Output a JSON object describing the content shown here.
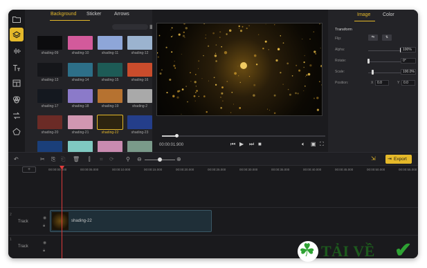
{
  "asset_panel": {
    "tabs": [
      "Background",
      "Sticker",
      "Arrows"
    ],
    "active_tab": 0,
    "thumbnails": [
      {
        "label": "shading-09",
        "color": "#0c0c0e",
        "selected": false
      },
      {
        "label": "shading-10",
        "color": "#d35a9b",
        "selected": false
      },
      {
        "label": "shading-11",
        "color": "#8ea6d8",
        "selected": false
      },
      {
        "label": "shading-12",
        "color": "#9bb3cf",
        "selected": false
      },
      {
        "label": "shading-13",
        "color": "#15161a",
        "selected": false
      },
      {
        "label": "shading-14",
        "color": "#2d6f88",
        "selected": false
      },
      {
        "label": "shading-15",
        "color": "#1d5b56",
        "selected": false
      },
      {
        "label": "shading-16",
        "color": "#c94c2c",
        "selected": false
      },
      {
        "label": "shading-17",
        "color": "#14181f",
        "selected": false
      },
      {
        "label": "shading-18",
        "color": "#8b7ac9",
        "selected": false
      },
      {
        "label": "shading-19",
        "color": "#b67230",
        "selected": false
      },
      {
        "label": "shading-2",
        "color": "#a9a9a9",
        "selected": false
      },
      {
        "label": "shading-20",
        "color": "#6b2b26",
        "selected": false
      },
      {
        "label": "shading-21",
        "color": "#d197b1",
        "selected": false
      },
      {
        "label": "shading-22",
        "color": "#2c2410",
        "selected": true
      },
      {
        "label": "shading-23",
        "color": "#243e8a",
        "selected": false
      },
      {
        "label": "",
        "color": "#1a3f7a",
        "selected": false
      },
      {
        "label": "",
        "color": "#7fc9c1",
        "selected": false
      },
      {
        "label": "",
        "color": "#c98bb0",
        "selected": false
      },
      {
        "label": "",
        "color": "#7a9a8a",
        "selected": false
      }
    ]
  },
  "preview": {
    "timecode": "00:00:01.900",
    "playback_progress_percent": 9
  },
  "properties": {
    "tabs": [
      "Image",
      "Color"
    ],
    "active_tab": 0,
    "section_title": "Transform",
    "flip_label": "Flip:",
    "alpha_label": "Alpha:",
    "alpha_value": "100%",
    "alpha_fraction": 1.0,
    "rotate_label": "Rotate:",
    "rotate_value": "0°",
    "scale_label": "Scale:",
    "scale_value": "100.0%",
    "scale_fraction": 0.1,
    "position_label": "Position:",
    "pos_x_label": "X",
    "pos_x_value": "0.0",
    "pos_y_label": "Y",
    "pos_y_value": "0.0"
  },
  "toolbar": {
    "export_label": "Export"
  },
  "timeline": {
    "ruler_ticks": [
      "00:00:00.000",
      "00:00:05.000",
      "00:00:10.000",
      "00:00:15.000",
      "00:00:20.000",
      "00:00:25.000",
      "00:00:30.000",
      "00:00:35.000",
      "00:00:40.000",
      "00:00:45.000",
      "00:00:50.000",
      "00:00:55.000"
    ],
    "tracks": [
      {
        "num": "2",
        "label": "Track"
      },
      {
        "num": "1",
        "label": "Track"
      }
    ],
    "clip_name": "shading-22"
  },
  "watermark": {
    "text": "TẢI VỀ"
  }
}
